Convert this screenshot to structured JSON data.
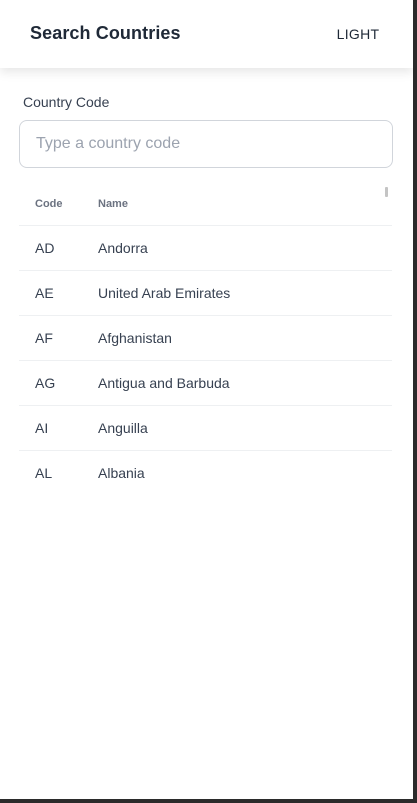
{
  "header": {
    "title": "Search Countries",
    "theme_toggle_label": "LIGHT"
  },
  "search": {
    "label": "Country Code",
    "value": "",
    "placeholder": "Type a country code"
  },
  "table": {
    "columns": {
      "code": "Code",
      "name": "Name"
    },
    "rows": [
      {
        "code": "AD",
        "name": "Andorra"
      },
      {
        "code": "AE",
        "name": "United Arab Emirates"
      },
      {
        "code": "AF",
        "name": "Afghanistan"
      },
      {
        "code": "AG",
        "name": "Antigua and Barbuda"
      },
      {
        "code": "AI",
        "name": "Anguilla"
      },
      {
        "code": "AL",
        "name": "Albania"
      }
    ]
  },
  "colors": {
    "text": "#1f2937",
    "muted": "#6b7280",
    "border": "#d1d5db",
    "background": "#ffffff"
  }
}
